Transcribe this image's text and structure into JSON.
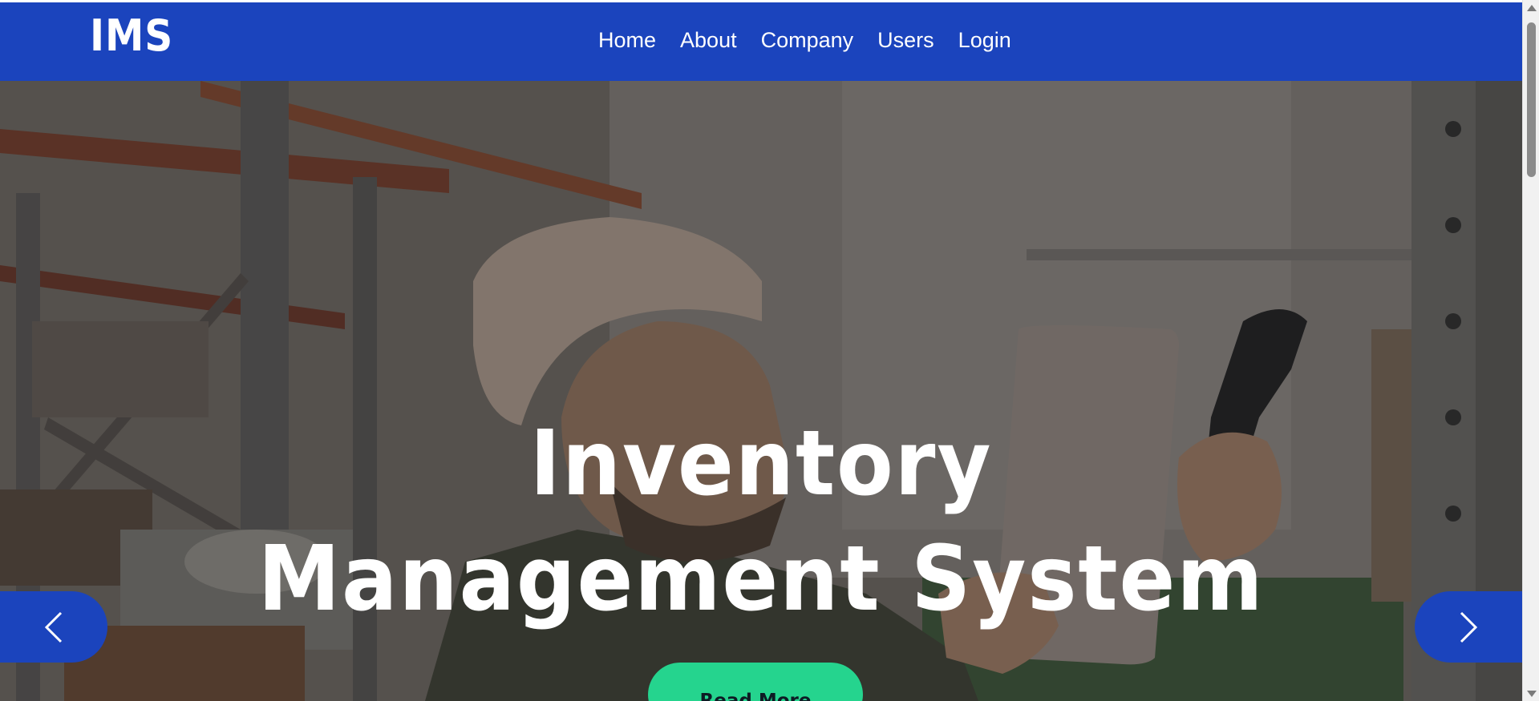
{
  "navbar": {
    "brand": "IMS",
    "links": [
      "Home",
      "About",
      "Company",
      "Users",
      "Login"
    ]
  },
  "hero": {
    "title_line1": "Inventory",
    "title_line2": "Management System",
    "cta_label": "Read More",
    "prev_icon": "chevron-left-icon",
    "next_icon": "chevron-right-icon",
    "background": "warehouse worker scanning with tablet and barcode scanner"
  },
  "colors": {
    "brand_blue": "#1b44bd",
    "cta_green": "#25d48e",
    "white": "#ffffff"
  }
}
